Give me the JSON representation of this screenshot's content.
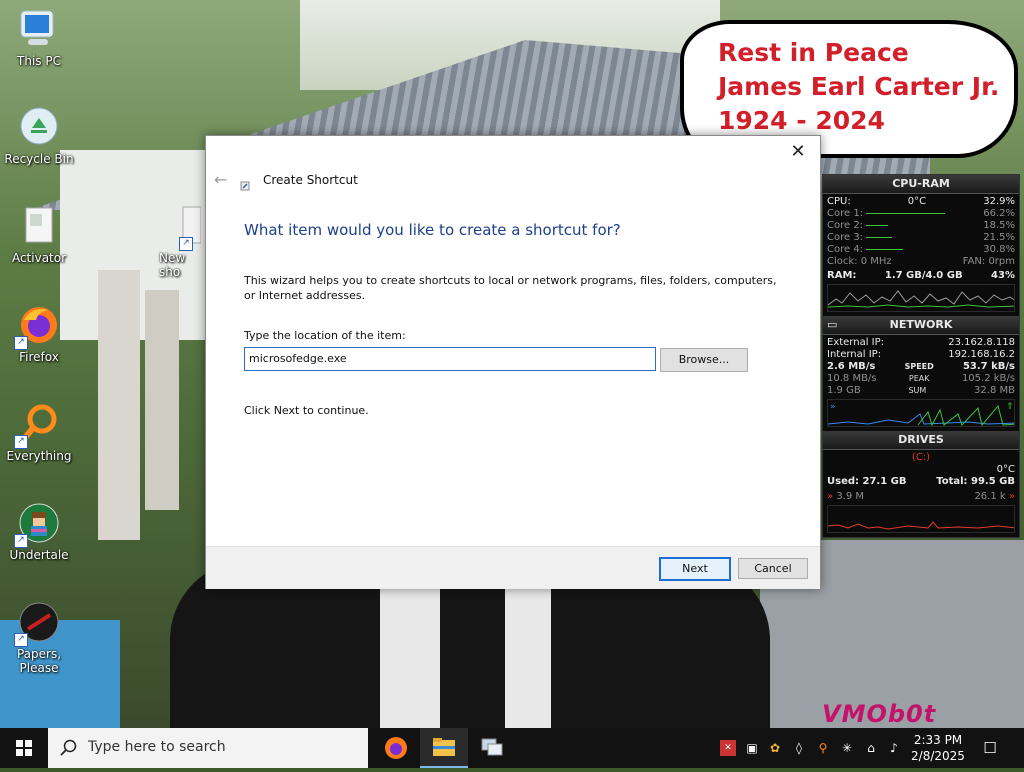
{
  "desktop": {
    "icons": [
      {
        "label": "This PC"
      },
      {
        "label": "Recycle Bin"
      },
      {
        "label": "Activator"
      },
      {
        "label": "Firefox"
      },
      {
        "label": "Everything"
      },
      {
        "label": "Undertale"
      },
      {
        "label": "Papers, Please"
      },
      {
        "label": "New sho"
      }
    ],
    "bubble_lines": [
      "Rest in Peace",
      "James Earl Carter Jr.",
      "1924 - 2024"
    ],
    "watermark": "VMOb0t"
  },
  "dialog": {
    "title": "Create Shortcut",
    "close_glyph": "✕",
    "back_glyph": "←",
    "heading": "What item would you like to create a shortcut for?",
    "description": "This wizard helps you to create shortcuts to local or network programs, files, folders, computers, or Internet addresses.",
    "location_label": "Type the location of the item:",
    "location_value": "microsofedge.exe",
    "browse_label": "Browse...",
    "continue_text": "Click Next to continue.",
    "next_label": "Next",
    "cancel_label": "Cancel"
  },
  "monitor": {
    "cpu_ram": {
      "header": "CPU-RAM",
      "cpu_label": "CPU:",
      "cpu_temp": "0°C",
      "cpu_value": "32.9%",
      "cores": [
        {
          "label": "Core 1:",
          "value": "66.2%",
          "fill": 0.66
        },
        {
          "label": "Core 2:",
          "value": "18.5%",
          "fill": 0.185
        },
        {
          "label": "Core 3:",
          "value": "21.5%",
          "fill": 0.215
        },
        {
          "label": "Core 4:",
          "value": "30.8%",
          "fill": 0.308
        }
      ],
      "clock_label": "Clock: 0 MHz",
      "fan_label": "FAN: 0rpm",
      "ram_label": "RAM:",
      "ram_value": "1.7 GB/4.0 GB",
      "ram_pct": "43%"
    },
    "network": {
      "header": "NETWORK",
      "external_label": "External IP:",
      "external_value": "23.162.8.118",
      "internal_label": "Internal IP:",
      "internal_value": "192.168.16.2",
      "speed_down": "2.6 MB/s",
      "speed_label": "SPEED",
      "speed_up": "53.7 kB/s",
      "peak_down": "10.8 MB/s",
      "peak_label": "PEAK",
      "peak_up": "105.2 kB/s",
      "sum_down": "1.9 GB",
      "sum_label": "SUM",
      "sum_up": "32.8 MB"
    },
    "drives": {
      "header": "DRIVES",
      "drive_letter": "(C:)",
      "temp": "0°C",
      "used_label": "Used: 27.1 GB",
      "total_label": "Total: 99.5 GB",
      "read": "3.9 M",
      "write": "26.1 k"
    }
  },
  "taskbar": {
    "search_placeholder": "Type here to search",
    "time": "2:33 PM",
    "date": "2/8/2025"
  }
}
